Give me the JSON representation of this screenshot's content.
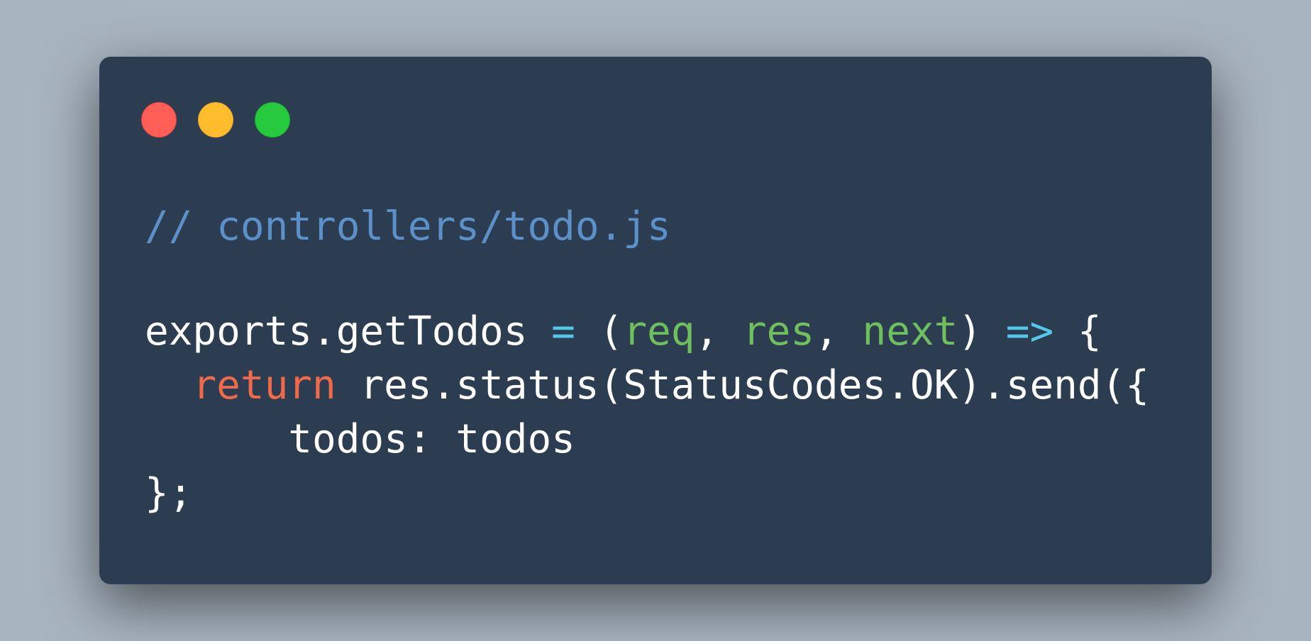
{
  "window": {
    "buttons": [
      "close",
      "minimize",
      "maximize"
    ],
    "colors": {
      "background": "#2c3d51",
      "close": "#ff5f56",
      "minimize": "#ffbd2e",
      "maximize": "#27c93f"
    }
  },
  "code": {
    "comment": "// controllers/todo.js",
    "line2": {
      "start": "exports.getTodos ",
      "eq": "=",
      "open": " (",
      "p1": "req",
      "sep1": ", ",
      "p2": "res",
      "sep2": ", ",
      "p3": "next",
      "close": ") ",
      "arrow": "=>",
      "brace": " {"
    },
    "line3": {
      "indent": "  ",
      "keyword": "return",
      "rest": " res.status(StatusCodes.OK).send({"
    },
    "line4": "      todos: todos",
    "line5": "};",
    "colors": {
      "comment": "#5b90c8",
      "keyword": "#ef6a4a",
      "param": "#6fbf5e",
      "operator": "#54c8ea",
      "text": "#ffffff"
    }
  }
}
